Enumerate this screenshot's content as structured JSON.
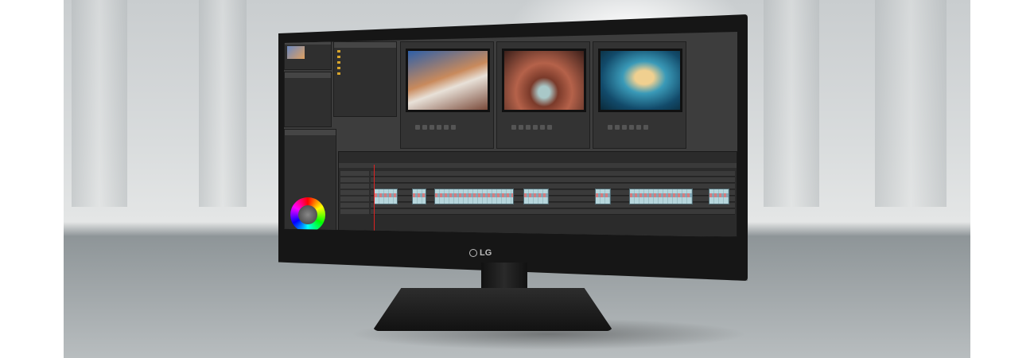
{
  "brand": {
    "logo_text": "LG"
  },
  "editor": {
    "monitors": [
      {
        "left_timecode": "",
        "right_timecode": "",
        "image": "snowboarder-in-red-suit"
      },
      {
        "left_timecode": "",
        "right_timecode": "",
        "image": "aerial-canyon-river"
      },
      {
        "left_timecode": "",
        "right_timecode": "",
        "image": "underwater-woman-portrait"
      }
    ],
    "icons": {
      "color_wheel": "color-wheel-icon",
      "folder": "folder-icon"
    }
  }
}
